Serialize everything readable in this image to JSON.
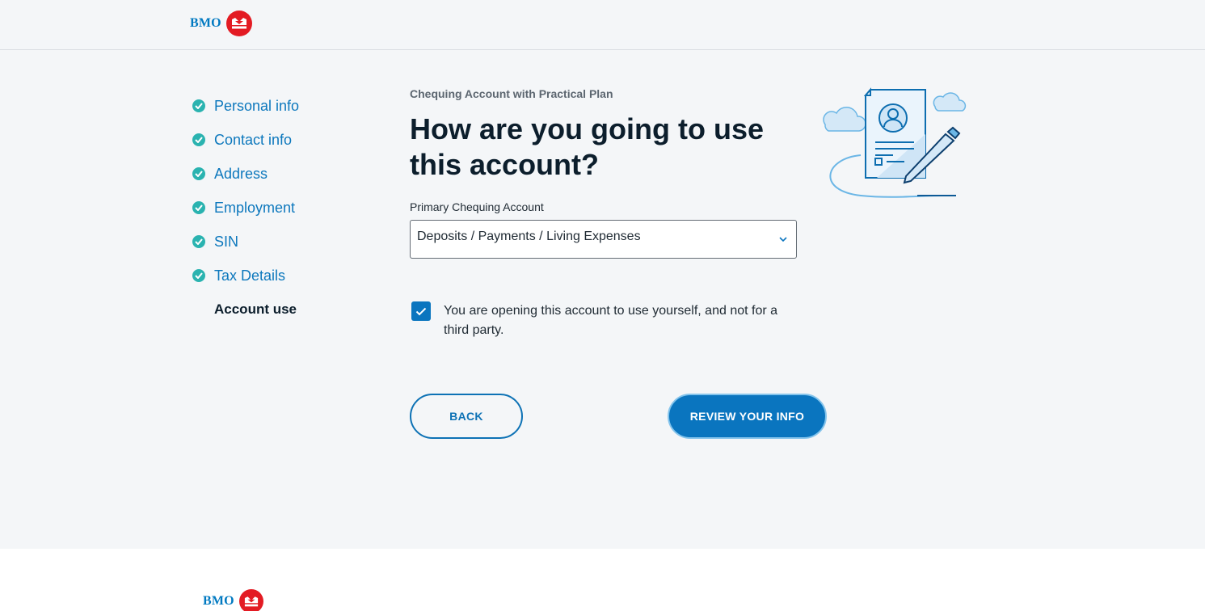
{
  "header": {
    "logo_text": "BMO"
  },
  "sidebar": {
    "steps": [
      {
        "label": "Personal info",
        "status": "complete"
      },
      {
        "label": "Contact info",
        "status": "complete"
      },
      {
        "label": "Address",
        "status": "complete"
      },
      {
        "label": "Employment",
        "status": "complete"
      },
      {
        "label": "SIN",
        "status": "complete"
      },
      {
        "label": "Tax Details",
        "status": "complete"
      },
      {
        "label": "Account use",
        "status": "current"
      }
    ]
  },
  "main": {
    "subtitle": "Chequing Account with Practical Plan",
    "title": "How are you going to use this account?",
    "field": {
      "label": "Primary Chequing Account",
      "selected_value": "Deposits / Payments / Living Expenses"
    },
    "checkbox": {
      "checked": true,
      "label": "You are opening this account to use yourself, and not for a third party."
    },
    "buttons": {
      "back": "BACK",
      "review": "REVIEW YOUR INFO"
    },
    "illustration": "document-with-pen-icon"
  },
  "footer": {
    "logo_text": "BMO"
  },
  "colors": {
    "brand_blue": "#0079c1",
    "brand_red": "#e31b23",
    "check_teal": "#2ab3b0",
    "link_blue": "#0d78bd"
  }
}
